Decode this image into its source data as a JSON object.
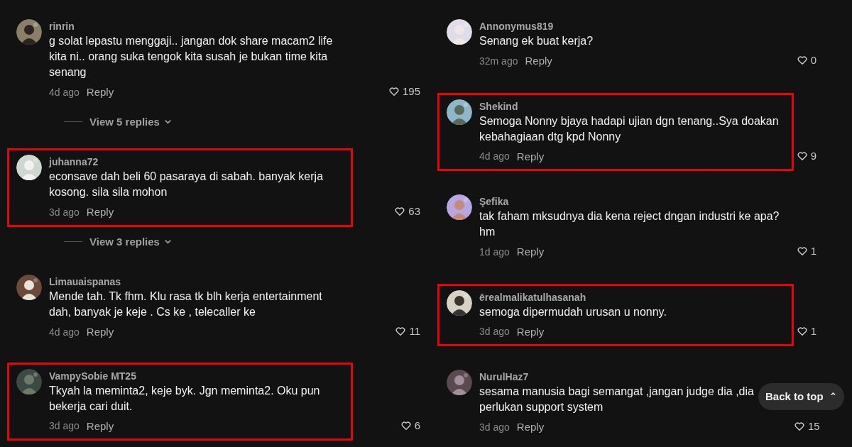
{
  "columns": [
    {
      "comments": [
        {
          "user": "rinrin",
          "text": "g solat lepastu menggaji.. jangan dok share macam2 life kita ni.. orang suka tengok kita susah je bukan time kita senang",
          "time": "4d ago",
          "reply": "Reply",
          "likes": "195",
          "highlighted": false,
          "view_replies": "View 5 replies"
        },
        {
          "user": "juhanna72",
          "text": "econsave dah beli 60 pasaraya di sabah. banyak kerja kosong. sila sila mohon",
          "time": "3d ago",
          "reply": "Reply",
          "likes": "63",
          "highlighted": true,
          "view_replies": "View 3 replies"
        },
        {
          "user": "Limauaispanas",
          "text": "Mende tah. Tk fhm. Klu rasa tk blh kerja entertainment dah, banyak je keje . Cs ke , telecaller ke",
          "time": "4d ago",
          "reply": "Reply",
          "likes": "11",
          "highlighted": false
        },
        {
          "user": "VampySobie MT25",
          "text": "Tkyah la meminta2, keje byk. Jgn meminta2. Oku pun bekerja cari duit.",
          "time": "3d ago",
          "reply": "Reply",
          "likes": "6",
          "highlighted": true
        }
      ]
    },
    {
      "comments": [
        {
          "user": "Annonymus819",
          "text": "Senang ek buat kerja?",
          "time": "32m ago",
          "reply": "Reply",
          "likes": "0",
          "highlighted": false
        },
        {
          "user": "Shekind",
          "text": "Semoga Nonny bjaya hadapi ujian dgn tenang..Sya doakan kebahagiaan dtg kpd Nonny",
          "time": "4d ago",
          "reply": "Reply",
          "likes": "9",
          "highlighted": true
        },
        {
          "user": "Şefika",
          "text": "tak faham mksudnya dia kena reject dngan industri ke apa? hm",
          "time": "1d ago",
          "reply": "Reply",
          "likes": "1",
          "highlighted": false
        },
        {
          "user": "ērealmalikatulhasanah",
          "text": "semoga dipermudah urusan u nonny.",
          "time": "3d ago",
          "reply": "Reply",
          "likes": "1",
          "highlighted": true
        },
        {
          "user": "NurulHaz7",
          "text": "sesama manusia bagi semangat ,jangan judge dia ,dia perlukan support system",
          "time": "3d ago",
          "reply": "Reply",
          "likes": "15",
          "highlighted": false
        }
      ]
    }
  ],
  "back_to_top": {
    "label": "Back to top",
    "icon": "⌃"
  }
}
